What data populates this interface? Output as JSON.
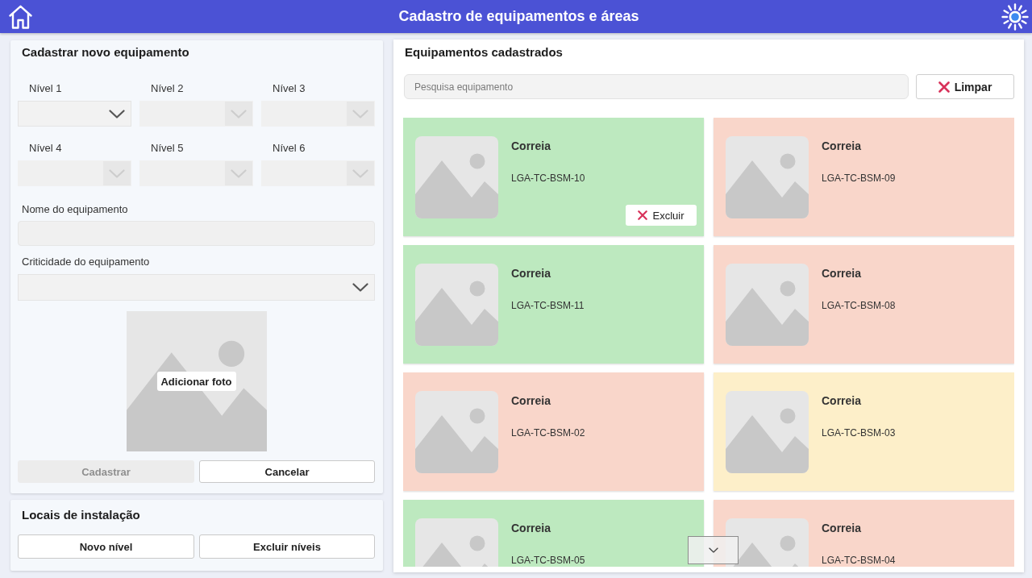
{
  "header": {
    "title": "Cadastro de equipamentos e áreas"
  },
  "new_equipment": {
    "title": "Cadastrar novo equipamento",
    "levels": [
      {
        "label": "Nível 1",
        "disabled": false
      },
      {
        "label": "Nível 2",
        "disabled": true
      },
      {
        "label": "Nível 3",
        "disabled": true
      },
      {
        "label": "Nível 4",
        "disabled": true
      },
      {
        "label": "Nível 5",
        "disabled": true
      },
      {
        "label": "Nível 6",
        "disabled": true
      }
    ],
    "name_field": {
      "label": "Nome do equipamento"
    },
    "criticality_field": {
      "label": "Criticidade do equipamento"
    },
    "photo": {
      "button": "Adicionar foto"
    },
    "buttons": [
      {
        "label": "Cadastrar",
        "disabled": true
      },
      {
        "label": "Cancelar",
        "disabled": false
      }
    ]
  },
  "installation_sites": {
    "title": "Locais de instalação",
    "buttons": [
      {
        "label": "Novo nível"
      },
      {
        "label": "Excluir níveis"
      }
    ]
  },
  "equipment_list": {
    "title": "Equipamentos cadastrados",
    "search": {
      "placeholder": "Pesquisa equipamento"
    },
    "clear_button": "Limpar",
    "cards": [
      {
        "name": "Correia",
        "code": "LGA-TC-BSM-10",
        "color": "#bde9bf",
        "delete_button": "Excluir"
      },
      {
        "name": "Correia",
        "code": "LGA-TC-BSM-09",
        "color": "#f9d6ca"
      },
      {
        "name": "Correia",
        "code": "LGA-TC-BSM-11",
        "color": "#bde9bf"
      },
      {
        "name": "Correia",
        "code": "LGA-TC-BSM-08",
        "color": "#f9d6ca"
      },
      {
        "name": "Correia",
        "code": "LGA-TC-BSM-02",
        "color": "#f9d6ca"
      },
      {
        "name": "Correia",
        "code": "LGA-TC-BSM-03",
        "color": "#fdefc9"
      },
      {
        "name": "Correia",
        "code": "LGA-TC-BSM-05",
        "color": "#bde9bf"
      },
      {
        "name": "Correia",
        "code": "LGA-TC-BSM-04",
        "color": "#f9d6ca"
      }
    ]
  }
}
